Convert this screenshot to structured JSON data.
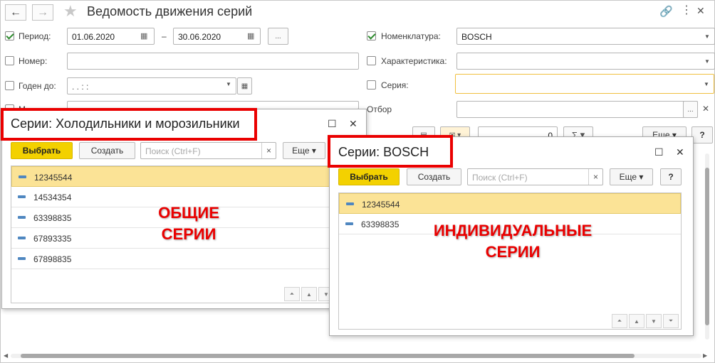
{
  "window": {
    "title": "Ведомость движения серий",
    "back_icon": "arrow-left-icon",
    "forward_icon": "arrow-right-icon",
    "favorite_icon": "star-icon"
  },
  "filters": {
    "period_label": "Период:",
    "period_from": "01.06.2020",
    "period_dash": "–",
    "period_to": "30.06.2020",
    "period_select": "...",
    "number_label": "Номер:",
    "number_value": "",
    "valid_label": "Годен до:",
    "valid_value": " .  .       :  :",
    "hidden_label": "М",
    "nomenclature_label": "Номенклатура:",
    "nomenclature_value": "BOSCH",
    "characteristic_label": "Характеристика:",
    "series_label": "Серия:",
    "selection_label": "Отбор",
    "selection_btn": "...",
    "number_field": "0",
    "more_label": "Еще",
    "help_label": "?",
    "sum_label": "Σ"
  },
  "popup_common": {
    "title": "Серии: Холодильники и морозильники",
    "select_btn": "Выбрать",
    "create_btn": "Создать",
    "search_placeholder": "Поиск (Ctrl+F)",
    "clear": "×",
    "more_btn": "Еще",
    "max": "☐",
    "close": "✕",
    "rows": [
      "12345544",
      "14534354",
      "63398835",
      "67893335",
      "67898835"
    ]
  },
  "popup_bosch": {
    "title": "Серии: BOSCH",
    "select_btn": "Выбрать",
    "create_btn": "Создать",
    "search_placeholder": "Поиск (Ctrl+F)",
    "clear": "×",
    "more_btn": "Еще",
    "help_btn": "?",
    "max": "☐",
    "close": "✕",
    "rows": [
      "12345544",
      "63398835"
    ]
  },
  "annotations": {
    "common_line1": "ОБЩИЕ",
    "common_line2": "СЕРИИ",
    "individual_line1": "ИНДИВИДУАЛЬНЫЕ",
    "individual_line2": "СЕРИИ"
  },
  "colors": {
    "accent_red": "#ea0000",
    "primary_button": "#f3d100",
    "selected_row": "#fbe396",
    "check_green": "#2e8b2e"
  }
}
